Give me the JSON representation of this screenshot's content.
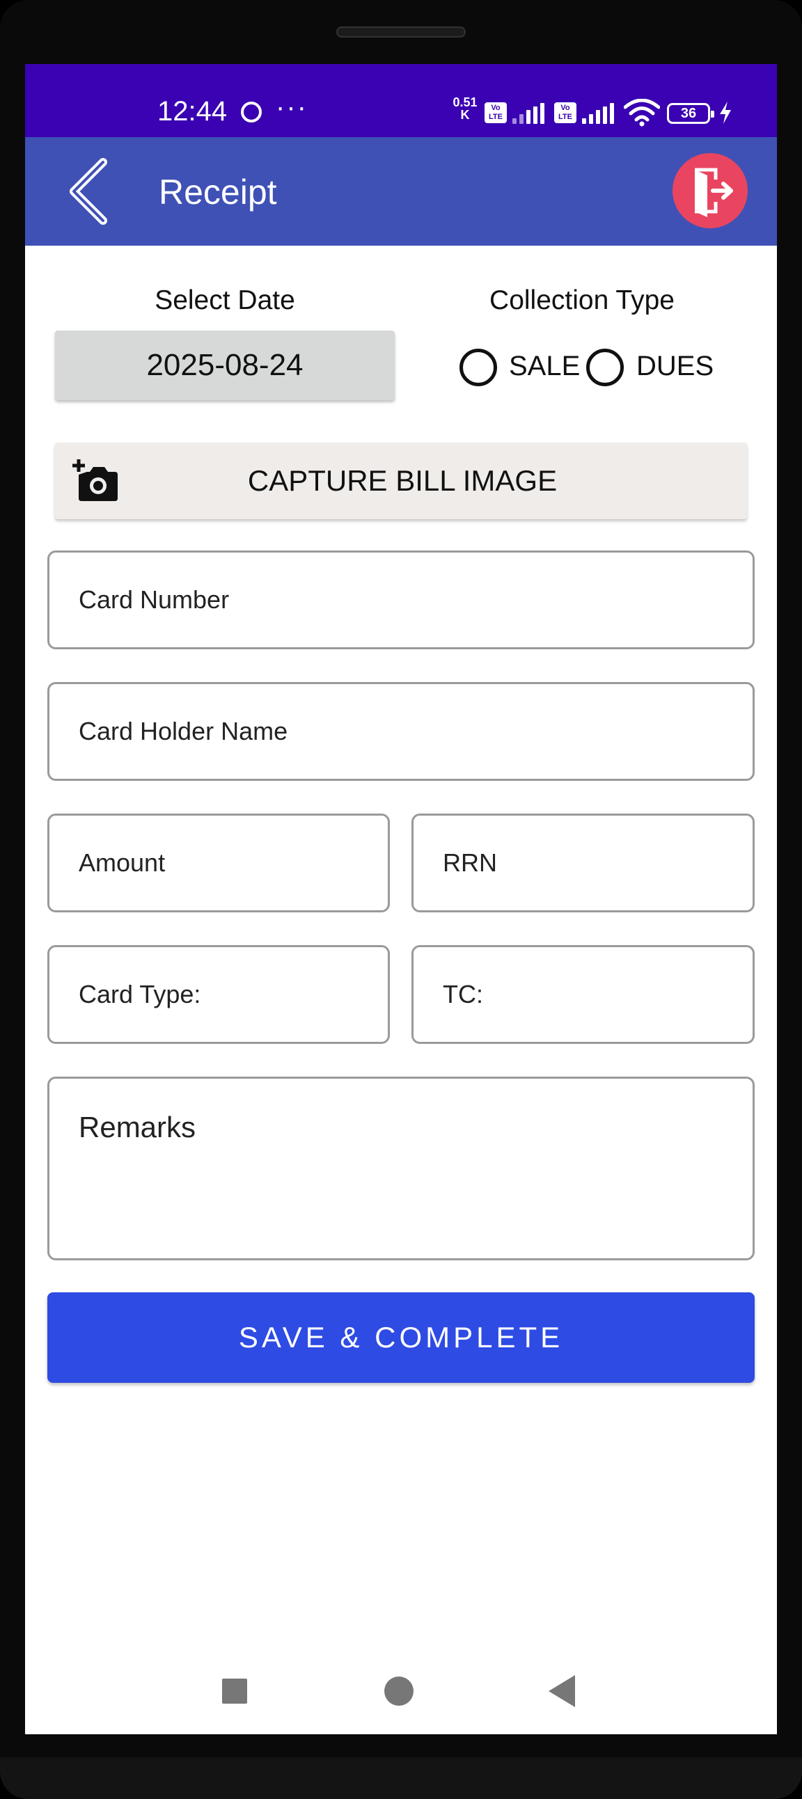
{
  "status_bar": {
    "time": "12:44",
    "more": "···",
    "net_speed_value": "0.51",
    "net_speed_unit": "K",
    "volte_1": "Vo\nLTE",
    "volte_2": "Vo\nLTE",
    "battery": "36",
    "bg_color": "#3a02b2"
  },
  "app_bar": {
    "title": "Receipt",
    "color": "#3f51b5",
    "back_icon": "chevron-left-icon",
    "logout_icon": "logout-door-icon",
    "logout_color": "#e94560"
  },
  "form": {
    "date_label": "Select Date",
    "date_value": "2025-08-24",
    "collection_type_label": "Collection Type",
    "collection_options": [
      "SALE",
      "DUES"
    ],
    "capture_label": "CAPTURE BILL IMAGE",
    "capture_icon": "add-camera-icon",
    "card_number_placeholder": "Card Number",
    "card_holder_placeholder": "Card Holder Name",
    "amount_placeholder": "Amount",
    "rrn_placeholder": "RRN",
    "card_type_placeholder": "Card Type:",
    "tc_placeholder": "TC:",
    "remarks_placeholder": "Remarks",
    "save_label": "SAVE & COMPLETE",
    "save_color": "#2e4be3"
  },
  "nav_bar": {
    "recents_icon": "square-icon",
    "home_icon": "circle-icon",
    "back_icon": "triangle-back-icon"
  }
}
